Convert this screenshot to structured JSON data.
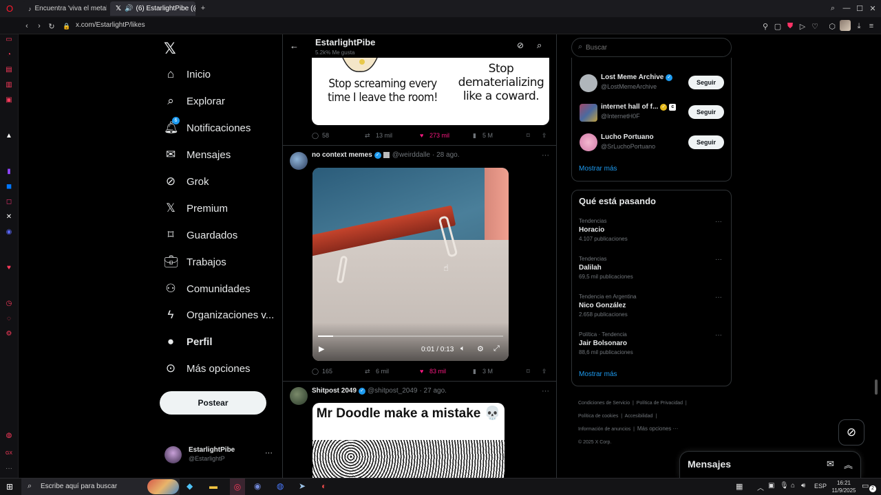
{
  "browser": {
    "tabs": [
      {
        "label": "Encuentra 'viva el metal' e",
        "icon": "tiktok-icon",
        "active": false
      },
      {
        "label": "(6) EstarlightPibe (@E",
        "icon": "x-logo-icon",
        "active": true
      }
    ],
    "url": "x.com/EstarlightP/likes"
  },
  "nav": {
    "items": [
      {
        "key": "home",
        "label": "Inicio",
        "icon": "home-icon"
      },
      {
        "key": "explore",
        "label": "Explorar",
        "icon": "search-icon"
      },
      {
        "key": "notifications",
        "label": "Notificaciones",
        "icon": "bell-icon",
        "badge": "6"
      },
      {
        "key": "messages",
        "label": "Mensajes",
        "icon": "mail-icon"
      },
      {
        "key": "grok",
        "label": "Grok",
        "icon": "grok-icon"
      },
      {
        "key": "premium",
        "label": "Premium",
        "icon": "x-logo-icon"
      },
      {
        "key": "bookmarks",
        "label": "Guardados",
        "icon": "bookmark-icon"
      },
      {
        "key": "jobs",
        "label": "Trabajos",
        "icon": "briefcase-icon"
      },
      {
        "key": "communities",
        "label": "Comunidades",
        "icon": "people-icon"
      },
      {
        "key": "orgs",
        "label": "Organizaciones v...",
        "icon": "lightning-icon"
      },
      {
        "key": "profile",
        "label": "Perfil",
        "icon": "person-icon"
      },
      {
        "key": "more",
        "label": "Más opciones",
        "icon": "more-circle-icon"
      }
    ],
    "post_label": "Postear",
    "account": {
      "name": "EstarlightPibe",
      "handle": "@EstarlightP"
    }
  },
  "header": {
    "title": "EstarlightPibe",
    "subtitle": "5.2k% Me gusta"
  },
  "posts": [
    {
      "meme_left": "Stop screaming every time I leave the room!",
      "meme_right": "Stop dematerializing like a coward.",
      "replies": "58",
      "reposts": "13 mil",
      "likes": "273 mil",
      "views": "5 M"
    },
    {
      "name": "no context memes",
      "handle": "@weirddalle",
      "date": "· 28 ago.",
      "video_time": "0:01 / 0:13",
      "replies": "165",
      "reposts": "6 mil",
      "likes": "83 mil",
      "views": "3 M"
    },
    {
      "name": "Shitpost 2049",
      "handle": "@shitpost_2049",
      "date": "· 27 ago.",
      "meme_title": "Mr Doodle make a mistake 💀"
    }
  ],
  "search": {
    "placeholder": "Buscar"
  },
  "who_to_follow": {
    "users": [
      {
        "name": "Lost Meme Archive",
        "handle": "@LostMemeArchive"
      },
      {
        "name": "internet hall of f...",
        "handle": "@InternetH0F"
      },
      {
        "name": "Lucho Portuano",
        "handle": "@SrLuchoPortuano"
      }
    ],
    "follow_label": "Seguir",
    "show_more": "Mostrar más"
  },
  "trends": {
    "title": "Qué está pasando",
    "items": [
      {
        "category": "Tendencias",
        "name": "Horacio",
        "count": "4.107 publicaciones"
      },
      {
        "category": "Tendencias",
        "name": "Dalilah",
        "count": "69,5 mil publicaciones"
      },
      {
        "category": "Tendencia en Argentina",
        "name": "Nico González",
        "count": "2.658 publicaciones"
      },
      {
        "category": "Política · Tendencia",
        "name": "Jair Bolsonaro",
        "count": "88,6 mil publicaciones"
      }
    ],
    "show_more": "Mostrar más"
  },
  "footer": {
    "links": [
      "Condiciones de Servicio",
      "Política de Privacidad",
      "Política de cookies",
      "Accesibilidad",
      "Información de anuncios",
      "Más opciones ···"
    ],
    "copyright": "© 2025 X Corp."
  },
  "messages_drawer": {
    "title": "Mensajes"
  },
  "taskbar": {
    "search_placeholder": "Escribe aquí para buscar",
    "language": "ESP",
    "time": "16:21",
    "date": "11/9/2025",
    "notifications": "2"
  },
  "colors": {
    "accent": "#1d9bf0",
    "like": "#f91880",
    "bg": "#000000",
    "border": "#2f3336"
  }
}
